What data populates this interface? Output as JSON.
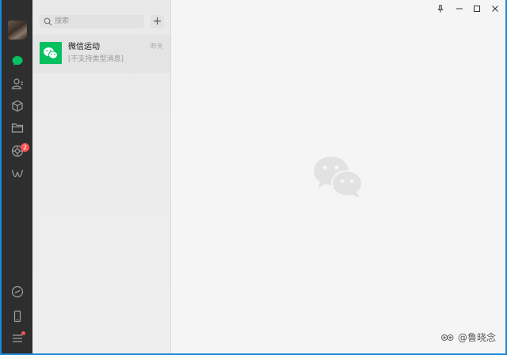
{
  "sidebar": {
    "icons": [
      "avatar",
      "chat-icon",
      "contacts-icon",
      "favorites-icon",
      "files-icon",
      "moments-icon",
      "channels-icon",
      "mini-program-icon",
      "phone-icon",
      "menu-icon"
    ],
    "moments_badge": "2"
  },
  "search": {
    "placeholder": "搜索"
  },
  "add_button": {
    "label": "+"
  },
  "chats": [
    {
      "name": "微信运动",
      "time": "昨天",
      "preview": "[不支持类型消息]"
    }
  ],
  "window_controls": [
    "pin",
    "minimize",
    "maximize",
    "close"
  ],
  "watermark": {
    "text": "@鲁晓念"
  },
  "colors": {
    "sidebar": "#2e2e2e",
    "accent": "#07c160",
    "badge": "#fa5151",
    "background": "#f5f5f5"
  }
}
